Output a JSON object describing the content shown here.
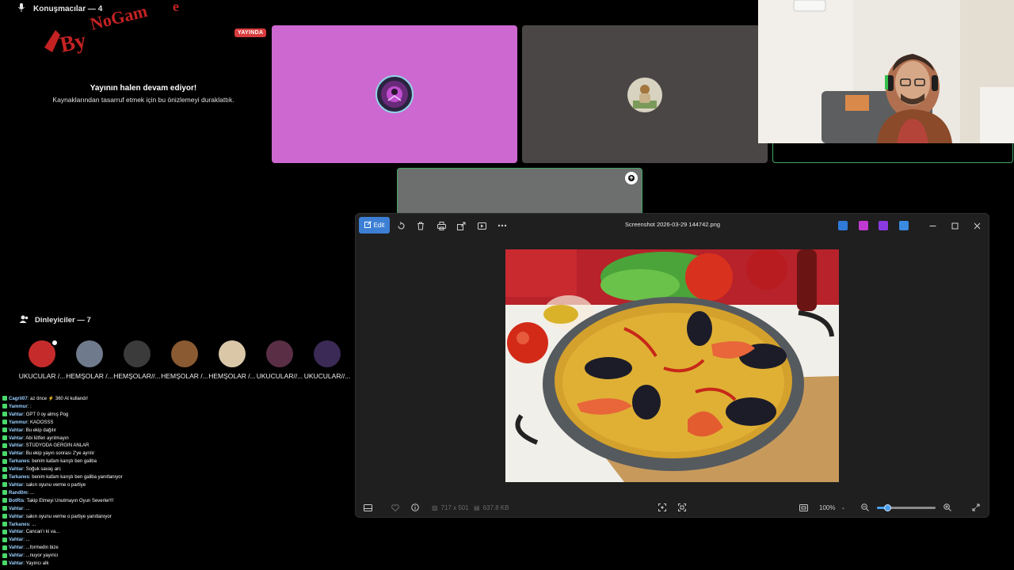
{
  "speakers": {
    "header": "Konuşmacılar — 4"
  },
  "stage": {
    "live_badge": "YAYINDA",
    "paused_title": "Yayının halen devam ediyor!",
    "paused_subtitle": "Kaynaklarından tasarruf etmek için bu önizlemeyi duraklattık."
  },
  "listeners": {
    "header": "Dinleyiciler — 7",
    "items": [
      {
        "name": "UKUCULAR /...",
        "color": "#c62b2b"
      },
      {
        "name": "HEMŞOLAR /...",
        "color": "#6f7a8c"
      },
      {
        "name": "HEMŞOLAR//...",
        "color": "#3b3b3b"
      },
      {
        "name": "HEMŞOLAR /...",
        "color": "#8a5a32"
      },
      {
        "name": "HEMŞOLAR /...",
        "color": "#d9c7a8"
      },
      {
        "name": "UKUCULAR//...",
        "color": "#5a2f45"
      },
      {
        "name": "UKUCULAR//...",
        "color": "#3a2a55"
      }
    ]
  },
  "chat": [
    {
      "user": "Cagrii07",
      "text": "az önce ⚡ 360 At kullandı!"
    },
    {
      "user": "Yammur",
      "text": ":"
    },
    {
      "user": "Vahtar",
      "text": "GPT 0 oy almış Pog"
    },
    {
      "user": "Yammur",
      "text": "KAOOSSS"
    },
    {
      "user": "Vahtar",
      "text": "Bu ekip dağılır"
    },
    {
      "user": "Vahtar",
      "text": "Abi lütfen ayrılmayın"
    },
    {
      "user": "Vahtar",
      "text": "STÜDYODA GERGİN ANLAR"
    },
    {
      "user": "Vahtar",
      "text": "Bu ekip yayın sonrası 2'ye ayrılır"
    },
    {
      "user": "Tarkanes",
      "text": "benim kafam karıştı ben galiba"
    },
    {
      "user": "Vahtar",
      "text": "Soğuk savaş arc"
    },
    {
      "user": "Tarkanes",
      "text": "benim kafam karıştı ben galiba yanıtlanıyor"
    },
    {
      "user": "Vahtar",
      "text": "sakın oyunu verme o partiye"
    },
    {
      "user": "Rand0m",
      "text": "..."
    },
    {
      "user": "BotRis",
      "text": "Takip Etmeyi Unutmayın Oyun Severler!!!"
    },
    {
      "user": "Vahtar",
      "text": "..."
    },
    {
      "user": "Vahtar",
      "text": "sakın oyunu verme o partiye yanıtlanıyor"
    },
    {
      "user": "Tarkanes",
      "text": "..."
    },
    {
      "user": "Vahtar",
      "text": "Cancan'ı ki va..."
    },
    {
      "user": "Vahtar",
      "text": "..."
    },
    {
      "user": "Vahtar",
      "text": "...formedin bize"
    },
    {
      "user": "Vahtar",
      "text": "...nuyor yayıncı"
    },
    {
      "user": "Vahtar",
      "text": "Yayıncı alk"
    }
  ],
  "viewer": {
    "edit_label": "Edit",
    "file_name": "Screenshot 2026-03-29 144742.png",
    "dimensions": "717 x 501",
    "file_size": "637.8 KB",
    "zoom": "100%",
    "zoom_level": 0.18
  },
  "icons": {
    "toolbar": [
      "rotate-icon",
      "delete-icon",
      "print-icon",
      "share-icon",
      "slideshow-icon",
      "more-icon"
    ],
    "window": [
      "minimize-icon",
      "maximize-icon",
      "close-icon"
    ]
  }
}
